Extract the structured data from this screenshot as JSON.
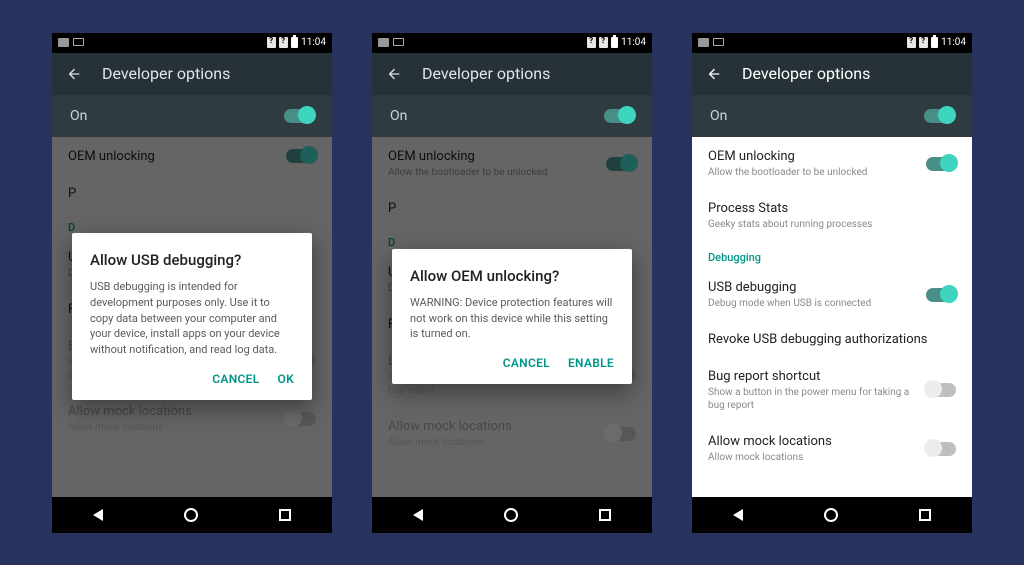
{
  "status": {
    "time": "11:04"
  },
  "header": {
    "title": "Developer options"
  },
  "onRow": {
    "label": "On"
  },
  "items": {
    "oem": {
      "title": "OEM unlocking",
      "sub": "Allow the bootloader to be unlocked"
    },
    "process": {
      "title": "Process Stats",
      "sub": "Geeky stats about running processes"
    },
    "debugSection": "Debugging",
    "usbDebug": {
      "title": "USB debugging",
      "sub": "Debug mode when USB is connected"
    },
    "revoke": {
      "title": "Revoke USB debugging authorizations"
    },
    "bugShortcut": {
      "title": "Bug report shortcut",
      "sub": "Show a button in the power menu for taking a bug report"
    },
    "mock": {
      "title": "Allow mock locations",
      "sub": "Allow mock locations"
    }
  },
  "dialog1": {
    "title": "Allow USB debugging?",
    "body": "USB debugging is intended for development purposes only. Use it to copy data between your computer and your device, install apps on your device without notification, and read log data.",
    "cancel": "CANCEL",
    "ok": "OK"
  },
  "dialog2": {
    "title": "Allow OEM unlocking?",
    "body": "WARNING: Device protection features will not work on this device while this setting is turned on.",
    "cancel": "CANCEL",
    "ok": "ENABLE"
  }
}
